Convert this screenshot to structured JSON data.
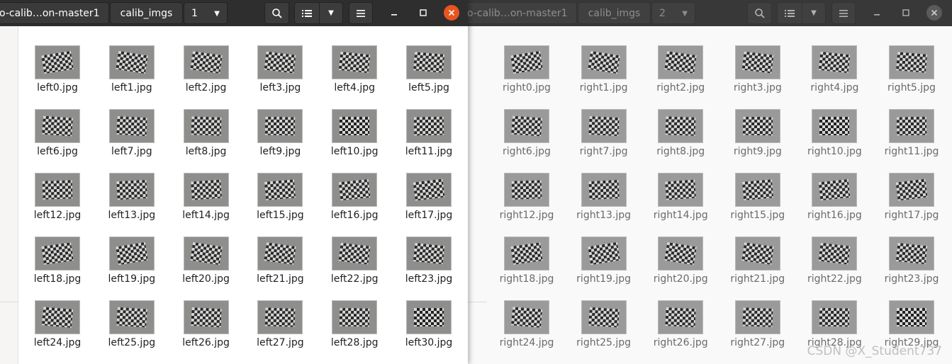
{
  "left_window": {
    "path": [
      "o-calib…on-master1",
      "calib_imgs",
      "1"
    ],
    "files": [
      "left0.jpg",
      "left1.jpg",
      "left2.jpg",
      "left3.jpg",
      "left4.jpg",
      "left5.jpg",
      "left6.jpg",
      "left7.jpg",
      "left8.jpg",
      "left9.jpg",
      "left10.jpg",
      "left11.jpg",
      "left12.jpg",
      "left13.jpg",
      "left14.jpg",
      "left15.jpg",
      "left16.jpg",
      "left17.jpg",
      "left18.jpg",
      "left19.jpg",
      "left20.jpg",
      "left21.jpg",
      "left22.jpg",
      "left23.jpg",
      "left24.jpg",
      "left25.jpg",
      "left26.jpg",
      "left27.jpg",
      "left28.jpg",
      "left30.jpg"
    ]
  },
  "right_window": {
    "path": [
      "o-calib…on-master1",
      "calib_imgs",
      "2"
    ],
    "files": [
      "right0.jpg",
      "right1.jpg",
      "right2.jpg",
      "right3.jpg",
      "right4.jpg",
      "right5.jpg",
      "right6.jpg",
      "right7.jpg",
      "right8.jpg",
      "right9.jpg",
      "right10.jpg",
      "right11.jpg",
      "right12.jpg",
      "right13.jpg",
      "right14.jpg",
      "right15.jpg",
      "right16.jpg",
      "right17.jpg",
      "right18.jpg",
      "right19.jpg",
      "right20.jpg",
      "right21.jpg",
      "right22.jpg",
      "right23.jpg",
      "right24.jpg",
      "right25.jpg",
      "right26.jpg",
      "right27.jpg",
      "right28.jpg",
      "right29.jpg"
    ]
  },
  "icons": {
    "dropdown": "chevron-down-icon",
    "search": "search-icon",
    "view": "list-view-icon",
    "menu": "hamburger-menu-icon",
    "minimize": "minimize-icon",
    "maximize": "maximize-icon",
    "close": "close-icon"
  },
  "colors": {
    "close_accent": "#e95420",
    "headerbar_dark": "#2e2e2e"
  },
  "watermark": "CSDN @X_Student737"
}
